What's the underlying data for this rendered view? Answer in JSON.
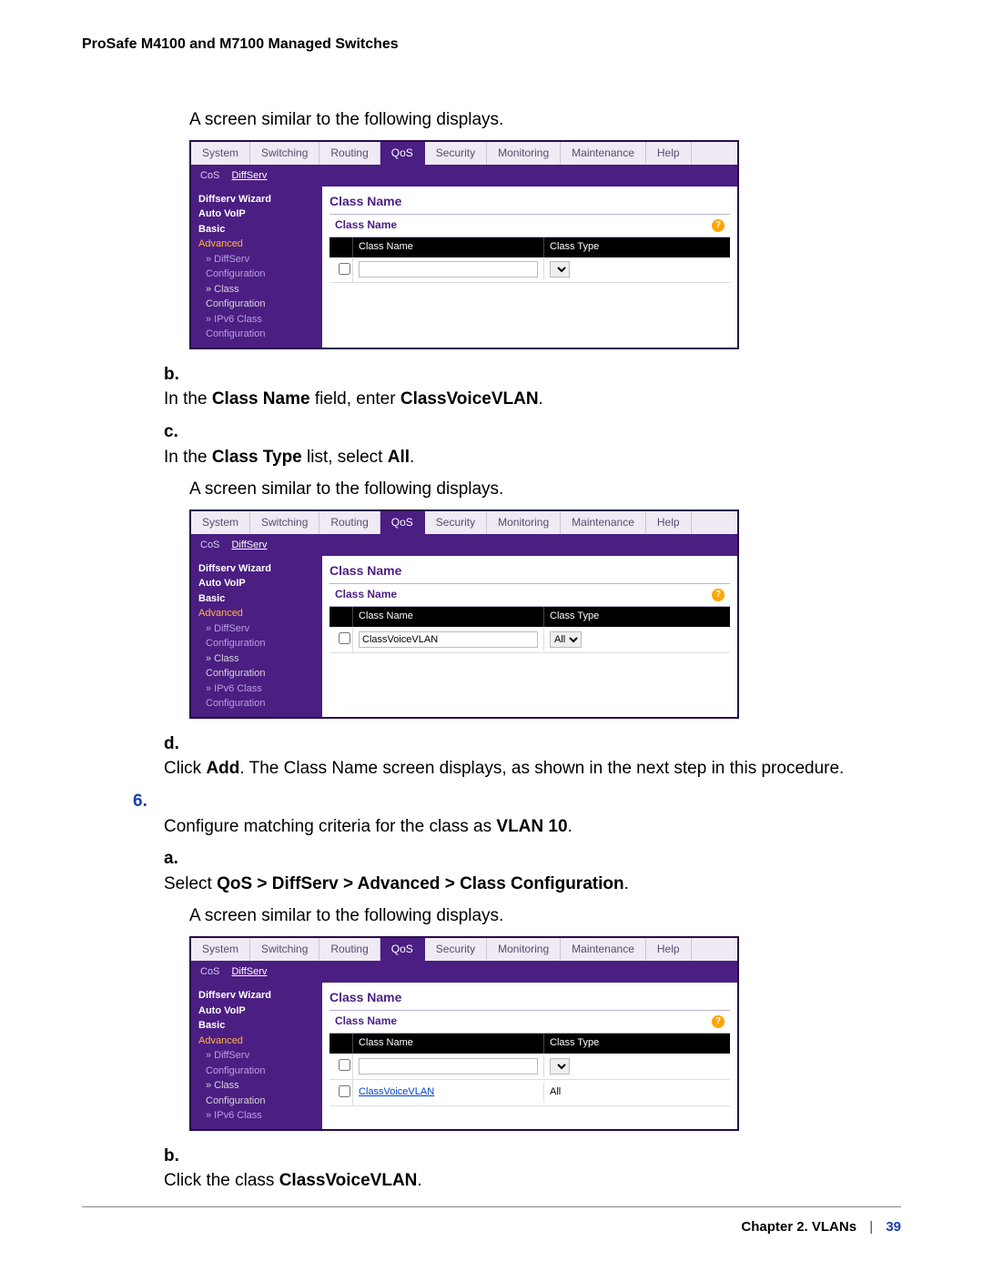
{
  "header": "ProSafe M4100 and M7100 Managed Switches",
  "intro_line": "A screen similar to the following displays.",
  "ui_common": {
    "tabs": [
      "System",
      "Switching",
      "Routing",
      "QoS",
      "Security",
      "Monitoring",
      "Maintenance",
      "Help"
    ],
    "active_tab": "QoS",
    "subtabs": {
      "cos": "CoS",
      "diffserv": "DiffServ"
    },
    "sidebar": {
      "wizard": "Diffserv Wizard",
      "autovoip": "Auto VoIP",
      "basic": "Basic",
      "advanced": "Advanced",
      "diffserv": "» DiffServ",
      "config_sub": "Configuration",
      "class": "» Class",
      "class_sub": "Configuration",
      "ipv6": "» IPv6 Class",
      "ipv6_sub": "Configuration"
    },
    "pane_title": "Class Name",
    "fieldset_label": "Class Name",
    "col_name": "Class Name",
    "col_type": "Class Type",
    "help_glyph": "?"
  },
  "shot1": {
    "row": {
      "name_value": "",
      "type_value": ""
    }
  },
  "step_b": {
    "marker": "b.",
    "pre": "In the ",
    "bold1": "Class Name",
    "mid": " field, enter ",
    "bold2": "ClassVoiceVLAN",
    "post": "."
  },
  "step_c": {
    "marker": "c.",
    "pre": "In the ",
    "bold1": "Class Type",
    "mid": " list, select ",
    "bold2": "All",
    "post": ".",
    "after": "A screen similar to the following displays."
  },
  "shot2": {
    "row": {
      "name_value": "ClassVoiceVLAN",
      "type_value": "All"
    }
  },
  "step_d": {
    "marker": "d.",
    "pre": "Click ",
    "bold1": "Add",
    "post": ". The Class Name screen displays, as shown in the next step in this procedure."
  },
  "step6": {
    "marker": "6.",
    "pre": "Configure matching criteria for the class as ",
    "bold1": "VLAN 10",
    "post": ".",
    "a_marker": "a.",
    "a_pre": "Select ",
    "a_bold": "QoS > DiffServ > Advanced > Class Configuration",
    "a_post": ".",
    "a_after": "A screen similar to the following displays."
  },
  "shot3": {
    "row_blank": {
      "name_value": "",
      "type_value": ""
    },
    "row_link": {
      "name_link": "ClassVoiceVLAN",
      "type_text": "All"
    }
  },
  "step_b2": {
    "marker": "b.",
    "pre": "Click the class ",
    "bold1": "ClassVoiceVLAN",
    "post": "."
  },
  "footer": {
    "chapter": "Chapter 2.  VLANs",
    "page": "39"
  }
}
